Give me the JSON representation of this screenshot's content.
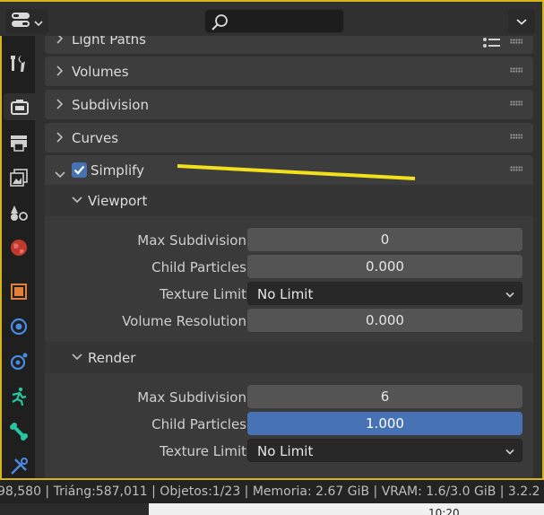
{
  "header": {
    "search_placeholder": ""
  },
  "tabs": [
    {
      "name": "tool",
      "icon": "wrench-screwdriver-icon"
    },
    {
      "name": "render",
      "icon": "camera-back-icon",
      "active": true
    },
    {
      "name": "output",
      "icon": "printer-icon"
    },
    {
      "name": "view-layer",
      "icon": "images-stack-icon"
    },
    {
      "name": "scene",
      "icon": "scene-shapes-icon"
    },
    {
      "name": "world",
      "icon": "globe-icon"
    },
    {
      "name": "object",
      "icon": "orange-square-icon"
    },
    {
      "name": "modifiers",
      "icon": "blue-circle-icon"
    },
    {
      "name": "particles",
      "icon": "particles-icon"
    },
    {
      "name": "physics",
      "icon": "running-figure-icon"
    },
    {
      "name": "constraints",
      "icon": "bone-icon"
    },
    {
      "name": "data",
      "icon": "tools-icon"
    }
  ],
  "panels": {
    "light_paths": "Light Paths",
    "volumes": "Volumes",
    "subdivision": "Subdivision",
    "curves": "Curves",
    "simplify": "Simplify"
  },
  "simplify": {
    "enabled": true,
    "viewport": {
      "title": "Viewport",
      "max_subdivision_label": "Max Subdivision",
      "max_subdivision": "0",
      "child_particles_label": "Child Particles",
      "child_particles": "0.000",
      "texture_limit_label": "Texture Limit",
      "texture_limit": "No Limit",
      "volume_resolution_label": "Volume Resolution",
      "volume_resolution": "0.000"
    },
    "render": {
      "title": "Render",
      "max_subdivision_label": "Max Subdivision",
      "max_subdivision": "6",
      "child_particles_label": "Child Particles",
      "child_particles": "1.000",
      "texture_limit_label": "Texture Limit",
      "texture_limit": "No Limit"
    }
  },
  "status_bar": {
    "text": "98,580 | Triáng:587,011 | Objetos:1/23 | Memoria: 2.67 GiB | VRAM: 1.6/3.0 GiB | 3.2.2"
  },
  "taskbar": {
    "clock": "10:20"
  },
  "colors": {
    "accent": "#4772b3",
    "border": "#d6b51c",
    "annotation": "#f2e01a"
  }
}
